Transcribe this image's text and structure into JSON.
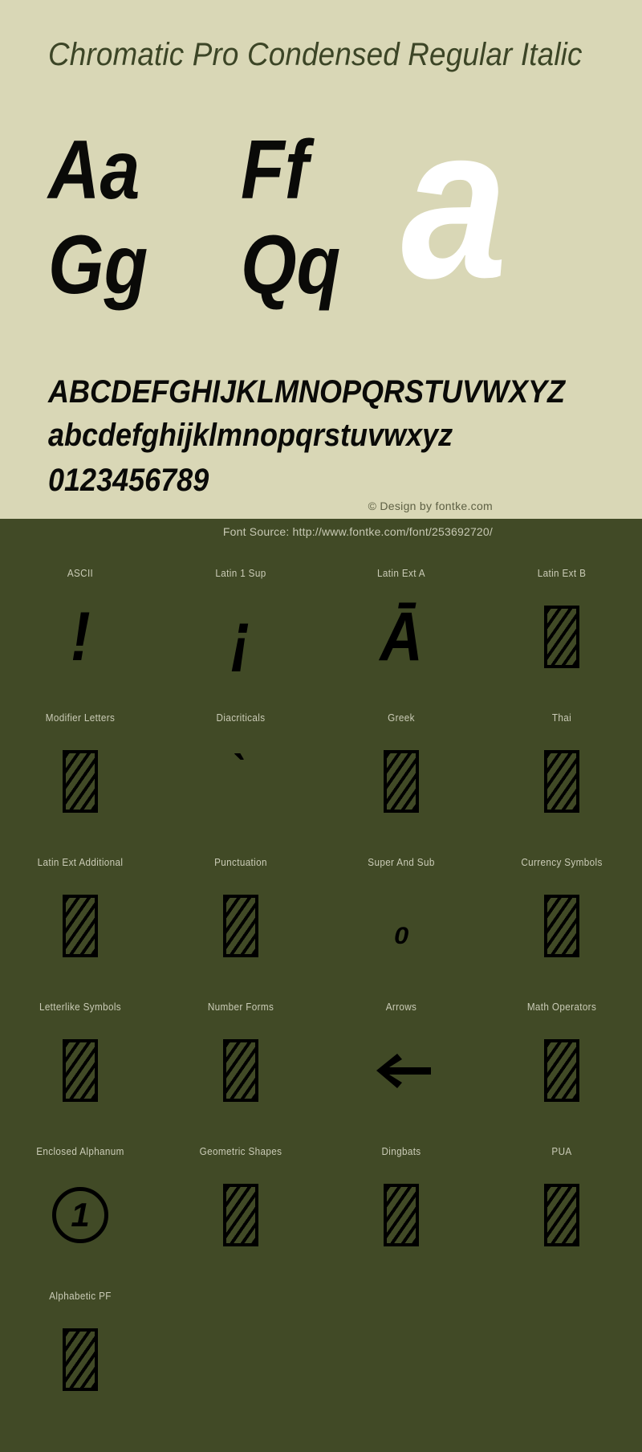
{
  "specimen": {
    "title": "Chromatic Pro Condensed Regular Italic",
    "big_samples": {
      "aa": "Aa",
      "ff": "Ff",
      "gg": "Gg",
      "qq": "Qq",
      "white_letter": "a"
    },
    "alphabet_uppercase": "ABCDEFGHIJKLMNOPQRSTUVWXYZ",
    "alphabet_lowercase": "abcdefghijklmnopqrstuvwxyz",
    "digits": "0123456789",
    "copyright": "© Design by fontke.com",
    "background_color": "#d9d7b6",
    "title_color": "#3c4526"
  },
  "coverage": {
    "source_text": "Font Source: http://www.fontke.com/font/253692720/",
    "background_color": "#414a26",
    "label_color": "#cbccb7",
    "rows": [
      [
        {
          "label": "ASCII",
          "glyph": "!",
          "kind": "char"
        },
        {
          "label": "Latin 1 Sup",
          "glyph": "¡",
          "kind": "char"
        },
        {
          "label": "Latin Ext A",
          "glyph": "Ā",
          "kind": "char"
        },
        {
          "label": "Latin Ext B",
          "glyph": "",
          "kind": "tofu"
        }
      ],
      [
        {
          "label": "Modifier Letters",
          "glyph": "",
          "kind": "tofu"
        },
        {
          "label": "Diacriticals",
          "glyph": "̀",
          "kind": "char-small"
        },
        {
          "label": "Greek",
          "glyph": "",
          "kind": "tofu"
        },
        {
          "label": "Thai",
          "glyph": "",
          "kind": "tofu"
        }
      ],
      [
        {
          "label": "Latin Ext Additional",
          "glyph": "",
          "kind": "tofu"
        },
        {
          "label": "Punctuation",
          "glyph": "",
          "kind": "tofu"
        },
        {
          "label": "Super And Sub",
          "glyph": "₀",
          "kind": "char-small"
        },
        {
          "label": "Currency Symbols",
          "glyph": "",
          "kind": "tofu"
        }
      ],
      [
        {
          "label": "Letterlike Symbols",
          "glyph": "",
          "kind": "tofu"
        },
        {
          "label": "Number Forms",
          "glyph": "",
          "kind": "tofu"
        },
        {
          "label": "Arrows",
          "glyph": "←",
          "kind": "arrow"
        },
        {
          "label": "Math Operators",
          "glyph": "",
          "kind": "tofu"
        }
      ],
      [
        {
          "label": "Enclosed Alphanum",
          "glyph": "1",
          "kind": "circled"
        },
        {
          "label": "Geometric Shapes",
          "glyph": "",
          "kind": "tofu"
        },
        {
          "label": "Dingbats",
          "glyph": "",
          "kind": "tofu"
        },
        {
          "label": "PUA",
          "glyph": "",
          "kind": "tofu"
        }
      ],
      [
        {
          "label": "Alphabetic PF",
          "glyph": "",
          "kind": "tofu"
        }
      ]
    ]
  }
}
